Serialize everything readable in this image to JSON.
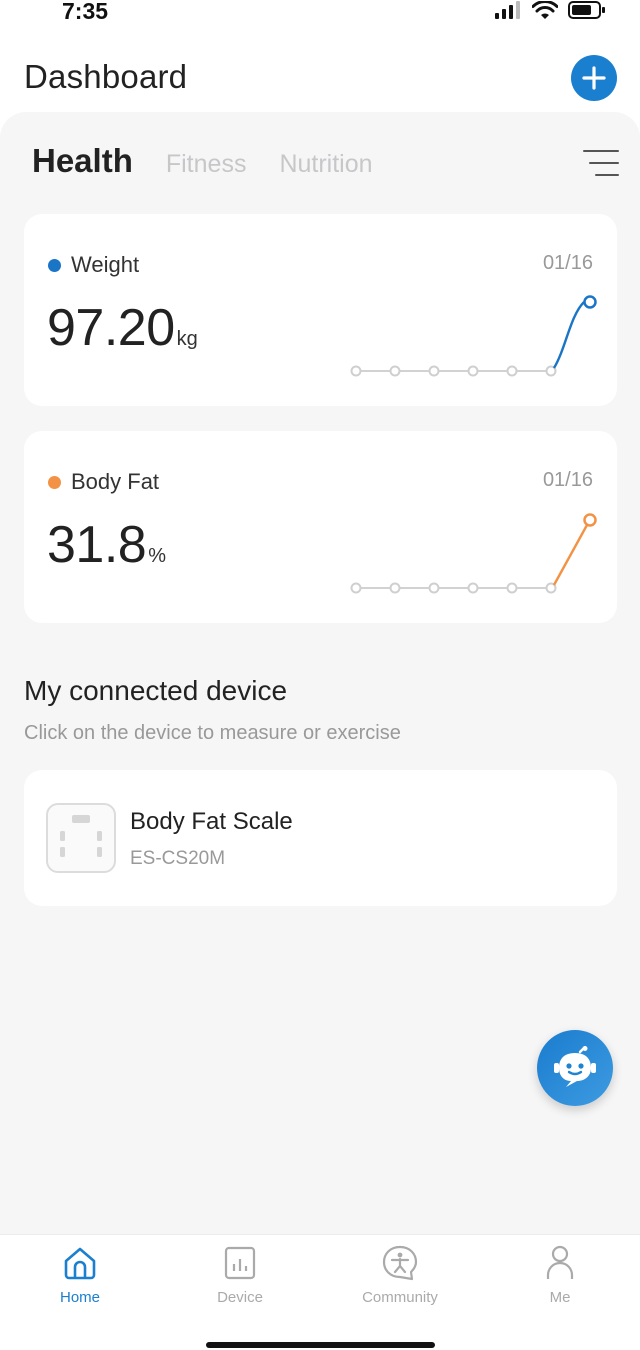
{
  "status_bar": {
    "time": "7:35"
  },
  "header": {
    "title": "Dashboard",
    "add_icon": "plus-icon"
  },
  "tabs": [
    {
      "label": "Health",
      "active": true
    },
    {
      "label": "Fitness",
      "active": false
    },
    {
      "label": "Nutrition",
      "active": false
    }
  ],
  "cards": [
    {
      "label": "Weight",
      "date": "01/16",
      "value": "97.20",
      "unit": "kg",
      "color": "#1b75c7"
    },
    {
      "label": "Body Fat",
      "date": "01/16",
      "value": "31.8",
      "unit": "%",
      "color": "#f39244"
    }
  ],
  "section": {
    "title": "My connected device",
    "subtitle": "Click on the device to measure or exercise"
  },
  "device": {
    "name": "Body Fat Scale",
    "model": "ES-CS20M",
    "icon": "scale-icon"
  },
  "assistant": {
    "icon": "robot-chat-icon"
  },
  "tabbar": [
    {
      "label": "Home",
      "icon": "home-icon",
      "active": true
    },
    {
      "label": "Device",
      "icon": "chart-icon",
      "active": false
    },
    {
      "label": "Community",
      "icon": "community-icon",
      "active": false
    },
    {
      "label": "Me",
      "icon": "person-icon",
      "active": false
    }
  ],
  "colors": {
    "accent": "#1b7fd0",
    "background": "#f6f6f7",
    "inactive": "#aaaaaa"
  }
}
